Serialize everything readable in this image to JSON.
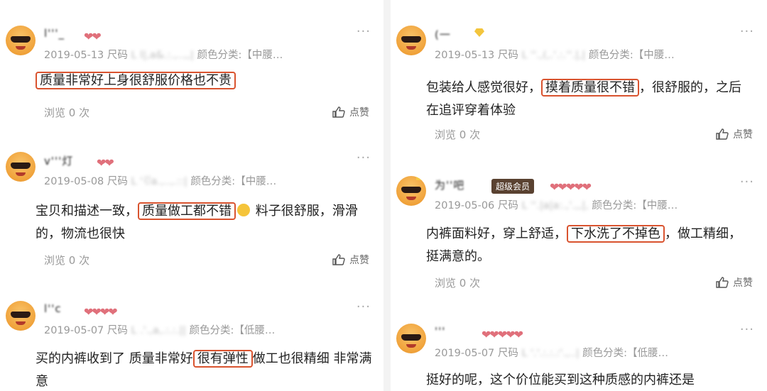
{
  "reviews": [
    {
      "nick": "l'''_",
      "hearts": "❤❤",
      "date": "2019-05-13",
      "size_label": "尺码",
      "size_blur": "L",
      "color_label": "颜色分类:【中腰…",
      "content_before": "",
      "highlight": "质量非常好上身很舒服价格也不贵",
      "content_after": "",
      "views": "浏览 0 次",
      "like": "点赞"
    },
    {
      "nick": "v'''灯",
      "hearts": "❤❤",
      "date": "2019-05-08",
      "size_label": "尺码",
      "size_blur": "L",
      "color_label": "颜色分类:【中腰…",
      "content_before": "宝贝和描述一致，",
      "highlight": "质量做工都不错",
      "content_after": " 料子很舒服，滑滑的，物流也很快",
      "views": "浏览 0 次",
      "like": "点赞"
    },
    {
      "nick": "l''c",
      "hearts": "❤❤❤❤",
      "date": "2019-05-07",
      "size_label": "尺码",
      "size_blur": "L",
      "color_label": "颜色分类:【低腰…",
      "content_before": "买的内裤收到了 质量非常好",
      "highlight": "很有弹性",
      "content_after": "做工也很精细 非常满意",
      "views": "",
      "like": ""
    },
    {
      "nick": "(一",
      "hearts": "",
      "date": "2019-05-13",
      "size_label": "尺码",
      "size_blur": "L",
      "color_label": "颜色分类:【中腰…",
      "content_before": "包装给人感觉很好，",
      "highlight": "摸着质量很不错",
      "content_after": "，很舒服的，之后在追评穿着体验",
      "views": "浏览 0 次",
      "like": "点赞"
    },
    {
      "nick": "为''吧",
      "badge": "超级会员",
      "hearts": "❤❤❤❤❤",
      "date": "2019-05-06",
      "size_label": "尺码",
      "size_blur": "L",
      "color_label": "颜色分类:【中腰…",
      "content_before": "内裤面料好，穿上舒适，",
      "highlight": "下水洗了不掉色",
      "content_after": "，做工精细，挺满意的。",
      "views": "浏览 0 次",
      "like": "点赞"
    },
    {
      "nick": "'''",
      "hearts": "❤❤❤❤❤",
      "date": "2019-05-07",
      "size_label": "尺码",
      "size_blur": "L",
      "color_label": "颜色分类:【低腰…",
      "content_before": "挺好的呢，这个价位能买到这种质感的内裤还是",
      "highlight": "",
      "content_after": "",
      "views": "",
      "like": ""
    }
  ],
  "colors": {
    "highlight_border": "#d9532f",
    "heart": "#e0707b",
    "meta": "#999999"
  },
  "icons": {
    "more": "more-dots-icon",
    "like": "thumbs-up-icon",
    "gem": "gem-icon",
    "avatar": "avatar-sunglasses-icon"
  }
}
